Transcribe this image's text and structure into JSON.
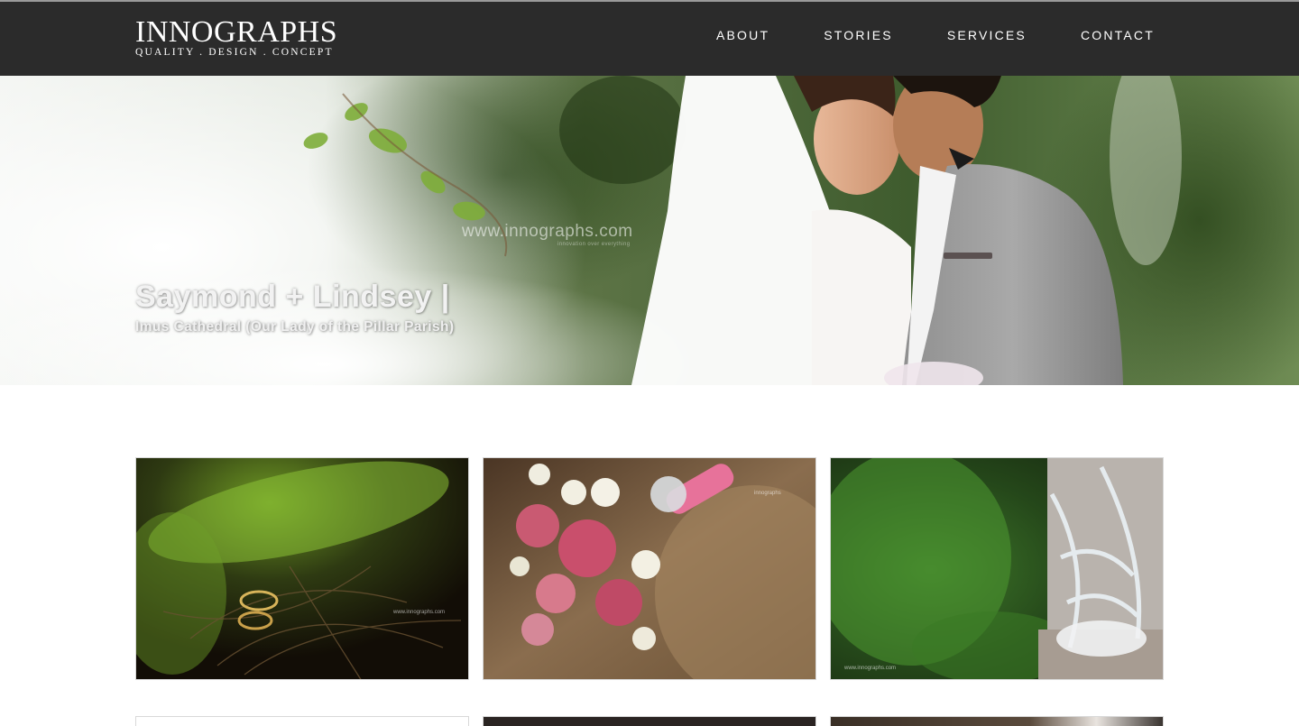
{
  "header": {
    "logo_title": "INNOGRAPHS",
    "logo_tagline": "QUALITY . DESIGN . CONCEPT",
    "nav": [
      {
        "label": "ABOUT"
      },
      {
        "label": "STORIES"
      },
      {
        "label": "SERVICES"
      },
      {
        "label": "CONTACT"
      }
    ]
  },
  "hero": {
    "title": "Saymond + Lindsey |",
    "subtitle": "Imus Cathedral (Our Lady of the Pillar Parish)",
    "watermark": "www.innographs.com",
    "watermark_tagline": "innovation over everything"
  },
  "gallery": {
    "thumbnails": [
      {
        "image": "wedding-rings-in-grass",
        "watermark": "www.innographs.com"
      },
      {
        "image": "bridal-bouquet-roses",
        "watermark": "innographs"
      },
      {
        "image": "bridal-shoes",
        "watermark": "www.innographs.com"
      }
    ]
  },
  "colors": {
    "header_bg": "#2b2b2b",
    "header_text": "#ffffff",
    "page_bg": "#ffffff"
  }
}
